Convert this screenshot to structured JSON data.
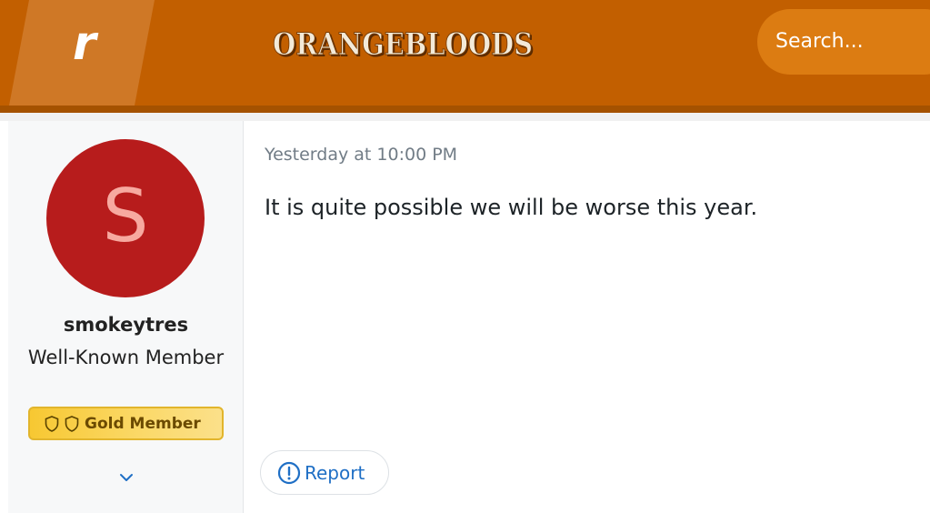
{
  "header": {
    "logo_letter": "r",
    "brand_name": "ORANGEBLOODS",
    "search": {
      "placeholder": "Search..."
    }
  },
  "post": {
    "author": {
      "avatar_letter": "S",
      "username": "smokeytres",
      "title": "Well-Known Member",
      "badge": "Gold Member"
    },
    "timestamp": "Yesterday at 10:00 PM",
    "body": "It is quite possible we will be worse this year.",
    "actions": {
      "report_label": "Report"
    }
  },
  "colors": {
    "header_bg": "#c25f00",
    "search_bg": "#dc7c12",
    "avatar_bg": "#b71c1c",
    "avatar_letter": "#f7a9a0",
    "badge_bg": "#f7c832",
    "link": "#1f6fc5"
  },
  "icons": {
    "badge_icons": [
      "shield-icon",
      "shield-icon"
    ],
    "expand": "chevron-down-icon",
    "report": "alert-circle-icon"
  }
}
